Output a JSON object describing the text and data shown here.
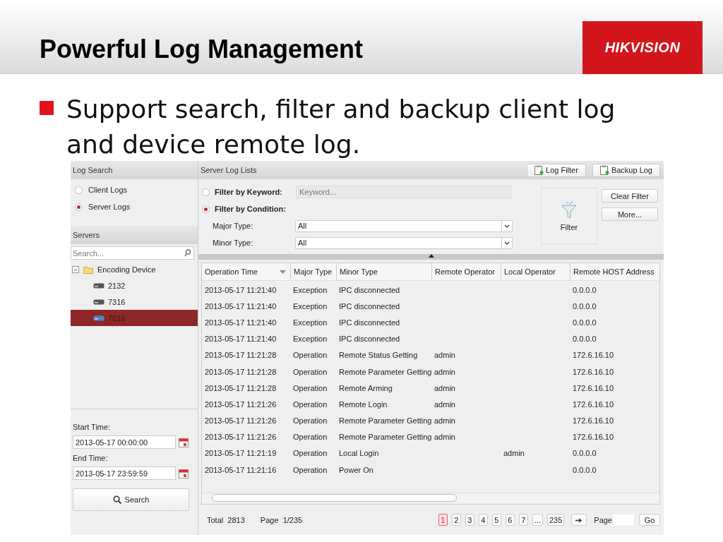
{
  "slide": {
    "title": "Powerful Log Management",
    "logo": "HIKVISION",
    "bullet": "Support search, filter and backup client log and device remote log."
  },
  "left_panel": {
    "title": "Log Search",
    "log_types": [
      {
        "label": "Client Logs",
        "selected": false
      },
      {
        "label": "Server Logs",
        "selected": true
      }
    ],
    "servers_title": "Servers",
    "search": {
      "placeholder": "Search..."
    },
    "tree": [
      {
        "label": "Encoding Device",
        "expanded": true,
        "children": [
          {
            "label": "2132",
            "selected": false
          },
          {
            "label": "7316",
            "selected": false
          },
          {
            "label": "7616",
            "selected": true
          }
        ]
      }
    ],
    "start_time": {
      "label": "Start Time:",
      "value": "2013-05-17 00:00:00"
    },
    "end_time": {
      "label": "End Time:",
      "value": "2013-05-17 23:59:59"
    },
    "search_button": "Search"
  },
  "right_panel": {
    "title": "Server Log Lists",
    "toolbar": [
      "Log Filter",
      "Backup Log"
    ],
    "filter_modes": [
      {
        "label": "Filter by Keyword:",
        "selected": false
      },
      {
        "label": "Filter by Condition:",
        "selected": true
      }
    ],
    "keyword": {
      "placeholder": "Keyword..."
    },
    "major_type": {
      "label": "Major Type:",
      "value": "All"
    },
    "minor_type": {
      "label": "Minor Type:",
      "value": "All"
    },
    "filter_button": "Filter",
    "side_buttons": [
      "Clear Filter",
      "More..."
    ],
    "table": {
      "columns": [
        "Operation Time",
        "Major Type",
        "Minor Type",
        "Remote Operator",
        "Local Operator",
        "Remote HOST Address"
      ],
      "rows": [
        [
          "2013-05-17 11:21:40",
          "Exception",
          "IPC disconnected",
          "",
          "",
          "0.0.0.0"
        ],
        [
          "2013-05-17 11:21:40",
          "Exception",
          "IPC disconnected",
          "",
          "",
          "0.0.0.0"
        ],
        [
          "2013-05-17 11:21:40",
          "Exception",
          "IPC disconnected",
          "",
          "",
          "0.0.0.0"
        ],
        [
          "2013-05-17 11:21:40",
          "Exception",
          "IPC disconnected",
          "",
          "",
          "0.0.0.0"
        ],
        [
          "2013-05-17 11:21:28",
          "Operation",
          "Remote Status Getting",
          "admin",
          "",
          "172.6.16.10"
        ],
        [
          "2013-05-17 11:21:28",
          "Operation",
          "Remote Parameter Getting",
          "admin",
          "",
          "172.6.16.10"
        ],
        [
          "2013-05-17 11:21:28",
          "Operation",
          "Remote Arming",
          "admin",
          "",
          "172.6.16.10"
        ],
        [
          "2013-05-17 11:21:26",
          "Operation",
          "Remote Login",
          "admin",
          "",
          "172.6.16.10"
        ],
        [
          "2013-05-17 11:21:26",
          "Operation",
          "Remote Parameter Getting",
          "admin",
          "",
          "172.6.16.10"
        ],
        [
          "2013-05-17 11:21:26",
          "Operation",
          "Remote Parameter Getting",
          "admin",
          "",
          "172.6.16.10"
        ],
        [
          "2013-05-17 11:21:19",
          "Operation",
          "Local Login",
          "",
          "admin",
          "0.0.0.0"
        ],
        [
          "2013-05-17 11:21:16",
          "Operation",
          "Power On",
          "",
          "",
          "0.0.0.0"
        ]
      ]
    },
    "pagination": {
      "total_label": "Total",
      "total": "2813",
      "page_label": "Page",
      "page": "1/235",
      "pages": [
        {
          "label": "1",
          "selected": true
        },
        {
          "label": "2",
          "selected": false
        },
        {
          "label": "3",
          "selected": false
        },
        {
          "label": "4",
          "selected": false
        },
        {
          "label": "5",
          "selected": false
        },
        {
          "label": "6",
          "selected": false
        },
        {
          "label": "7",
          "selected": false
        },
        {
          "label": "...",
          "selected": false
        },
        {
          "label": "235",
          "selected": false
        }
      ],
      "goto_label": "Page",
      "go_button": "Go"
    }
  }
}
